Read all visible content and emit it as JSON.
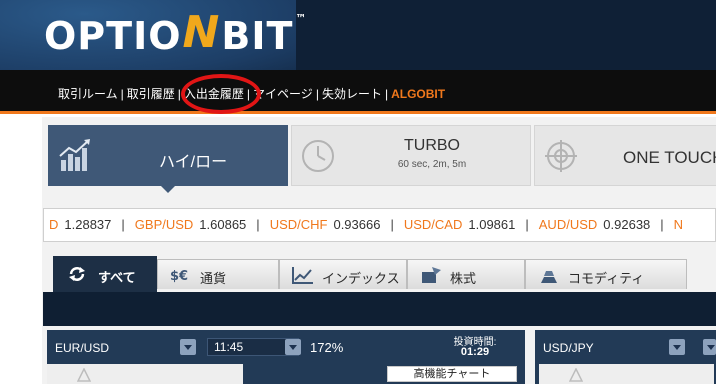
{
  "logo": {
    "text_a": "OPTIO",
    "text_n": "N",
    "text_b": "BIT",
    "tm": "™"
  },
  "nav": {
    "items": [
      "取引ルーム",
      "取引履歴",
      "入出金履歴",
      "マイページ",
      "失効レート",
      "ALGOBIT"
    ],
    "separator": "|"
  },
  "trade_types": {
    "hilo": {
      "label": "ハイ/ロー",
      "icon": "bar-chart-icon"
    },
    "turbo": {
      "label": "TURBO",
      "sub": "60 sec, 2m, 5m",
      "icon": "clock-icon"
    },
    "touch": {
      "label": "ONE TOUCH",
      "icon": "target-icon"
    }
  },
  "ticker": [
    {
      "pair": "D",
      "value": "1.28837"
    },
    {
      "pair": "GBP/USD",
      "value": "1.60865"
    },
    {
      "pair": "USD/CHF",
      "value": "0.93666"
    },
    {
      "pair": "USD/CAD",
      "value": "1.09861"
    },
    {
      "pair": "AUD/USD",
      "value": "0.92638"
    },
    {
      "pair": "N",
      "value": ""
    }
  ],
  "ticker_sep": "|",
  "categories": [
    {
      "label": "すべて",
      "icon": "refresh-icon"
    },
    {
      "label": "通貨",
      "icon": "currency-icon"
    },
    {
      "label": "インデックス",
      "icon": "index-chart-icon"
    },
    {
      "label": "株式",
      "icon": "stock-icon"
    },
    {
      "label": "コモディティ",
      "icon": "gold-bars-icon"
    }
  ],
  "assets": [
    {
      "pair": "EUR/USD",
      "time": "11:45",
      "payout": "172%",
      "invest_label": "投資時間:",
      "invest_time": "01:29",
      "chart_button": "高機能チャート"
    },
    {
      "pair": "USD/JPY"
    }
  ],
  "colors": {
    "accent": "#f0781c",
    "panel": "#3f5877",
    "header": "#112641",
    "circle": "#e11515"
  }
}
